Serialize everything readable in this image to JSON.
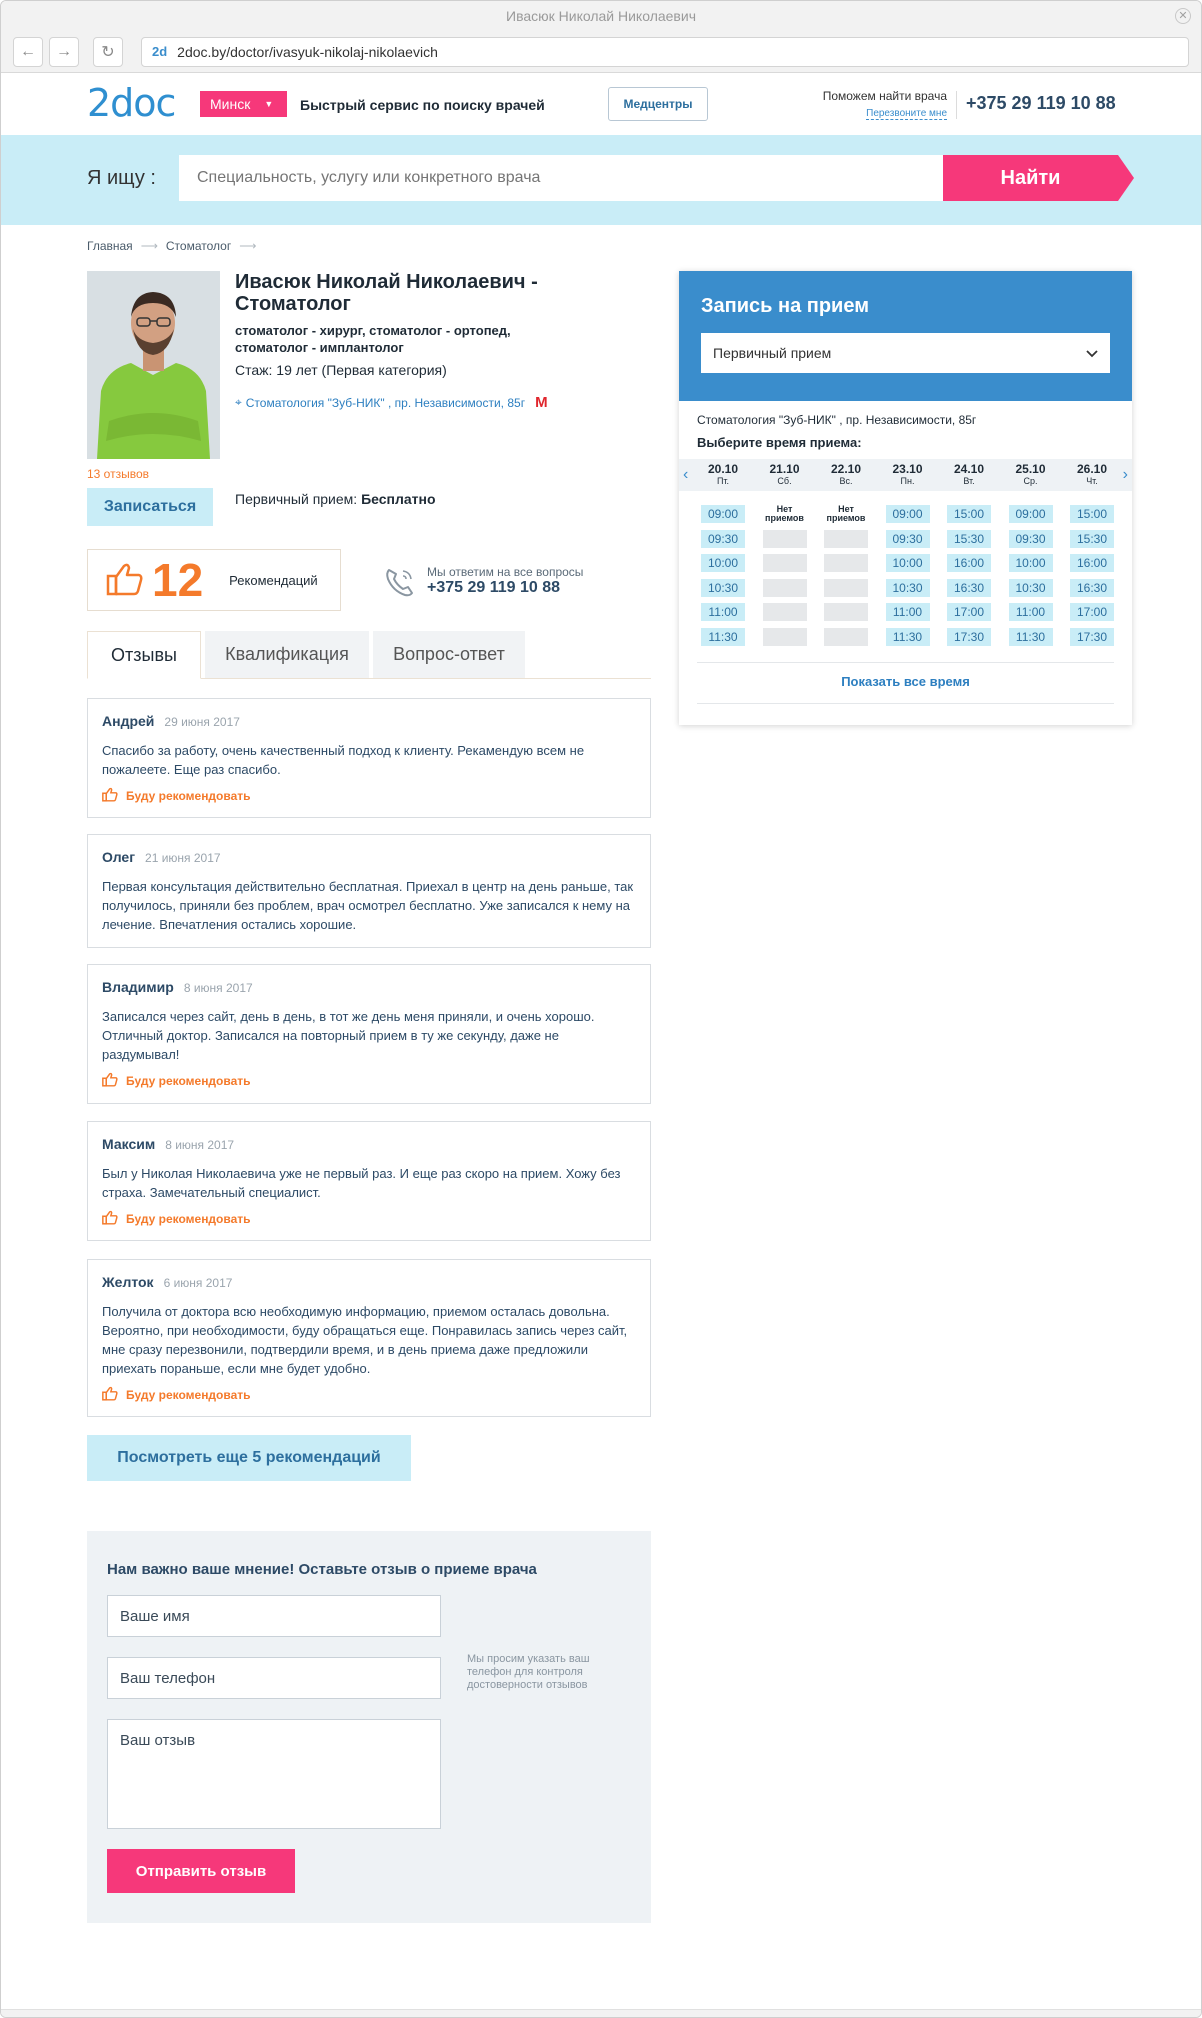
{
  "browser": {
    "window_title": "Ивасюк Николай Николаевич",
    "url_favicon": "2d",
    "url": "2doc.by/doctor/ivasyuk-nikolaj-nikolaevich"
  },
  "header": {
    "logo": "2doc",
    "city": "Минск",
    "tagline": "Быстрый сервис по поиску врачей",
    "medcenters_label": "Медцентры",
    "help_text": "Поможем найти врача",
    "callback_link": "Перезвоните мне",
    "phone": "+375 29 119 10 88"
  },
  "search": {
    "label": "Я ищу :",
    "placeholder": "Специальность, услугу или конкретного врача",
    "button": "Найти"
  },
  "breadcrumb": [
    "Главная",
    "Стоматолог"
  ],
  "doctor": {
    "name": "Ивасюк Николай Николаевич - Стоматолог",
    "specialties": "стоматолог - хирург, стоматолог - ортопед, стоматолог - имплантолог",
    "experience_label": "Стаж:",
    "experience_value": "19 лет (Первая категория)",
    "address": "Стоматология \"Зуб-НИК\" , пр. Независимости, 85г",
    "reviews_count": "13 отзывов",
    "book_button": "Записаться",
    "first_visit_label": "Первичный прием:",
    "first_visit_value": "Бесплатно"
  },
  "recommendations": {
    "count": "12",
    "label": "Рекомендаций"
  },
  "answer": {
    "text": "Мы ответим на все вопросы",
    "phone": "+375 29 119 10 88"
  },
  "tabs": [
    "Отзывы",
    "Квалификация",
    "Вопрос-ответ"
  ],
  "recommend_label": "Буду рекомендовать",
  "reviews": [
    {
      "name": "Андрей",
      "date": "29 июня 2017",
      "text": "Спасибо за работу, очень качественный подход к клиенту. Рекамендую всем не пожалеете. Еще раз спасибо.",
      "recommend": true
    },
    {
      "name": "Олег",
      "date": "21 июня 2017",
      "text": "Первая консультация действительно бесплатная. Приехал в центр на день раньше, так получилось, приняли без проблем, врач осмотрел бесплатно. Уже записался к нему на лечение. Впечатления остались хорошие.",
      "recommend": false
    },
    {
      "name": "Владимир",
      "date": "8 июня 2017",
      "text": "Записался через сайт, день в день, в тот же день меня приняли, и очень хорошо. Отличный доктор. Записался на повторный прием в ту же секунду, даже не раздумывал!",
      "recommend": true
    },
    {
      "name": "Максим",
      "date": "8 июня 2017",
      "text": "Был у Николая Николаевича уже не первый раз. И еще раз скоро на прием. Хожу без страха. Замечательный специалист.",
      "recommend": true
    },
    {
      "name": "Желток",
      "date": "6 июня 2017",
      "text": "Получила от доктора всю необходимую информацию, приемом осталась довольна. Вероятно, при необходимости, буду обращаться еще. Понравилась запись через сайт, мне сразу перезвонили, подтвердили время, и в день приема даже предложили приехать пораньше, если мне будет удобно.",
      "recommend": true
    }
  ],
  "more_button": "Посмотреть еще 5 рекомендаций",
  "feedback": {
    "title": "Нам важно ваше мнение! Оставьте отзыв о приеме врача",
    "name_placeholder": "Ваше имя",
    "phone_placeholder": "Ваш телефон",
    "review_placeholder": "Ваш отзыв",
    "hint": "Мы просим указать ваш телефон для контроля достоверности отзывов",
    "submit": "Отправить отзыв"
  },
  "booking": {
    "title": "Запись на прием",
    "visit_type": "Первичный прием",
    "clinic": "Стоматология \"Зуб-НИК\" , пр. Независимости, 85г",
    "choose_time": "Выберите время приема:",
    "no_appointments": "Нет приемов",
    "show_all": "Показать все время",
    "days": [
      {
        "date": "20.10",
        "weekday": "Пт.",
        "slots": [
          "09:00",
          "09:30",
          "10:00",
          "10:30",
          "11:00",
          "11:30"
        ]
      },
      {
        "date": "21.10",
        "weekday": "Сб.",
        "slots": []
      },
      {
        "date": "22.10",
        "weekday": "Вс.",
        "slots": []
      },
      {
        "date": "23.10",
        "weekday": "Пн.",
        "slots": [
          "09:00",
          "09:30",
          "10:00",
          "10:30",
          "11:00",
          "11:30"
        ]
      },
      {
        "date": "24.10",
        "weekday": "Вт.",
        "slots": [
          "15:00",
          "15:30",
          "16:00",
          "16:30",
          "17:00",
          "17:30"
        ]
      },
      {
        "date": "25.10",
        "weekday": "Ср.",
        "slots": [
          "09:00",
          "09:30",
          "10:00",
          "10:30",
          "11:00",
          "11:30"
        ]
      },
      {
        "date": "26.10",
        "weekday": "Чт.",
        "slots": [
          "15:00",
          "15:30",
          "16:00",
          "16:30",
          "17:00",
          "17:30"
        ]
      }
    ]
  },
  "colors": {
    "brand_blue": "#3a8dcc",
    "accent_pink": "#f6387a",
    "accent_orange": "#f47a2b",
    "light_cyan": "#c9edf7"
  }
}
